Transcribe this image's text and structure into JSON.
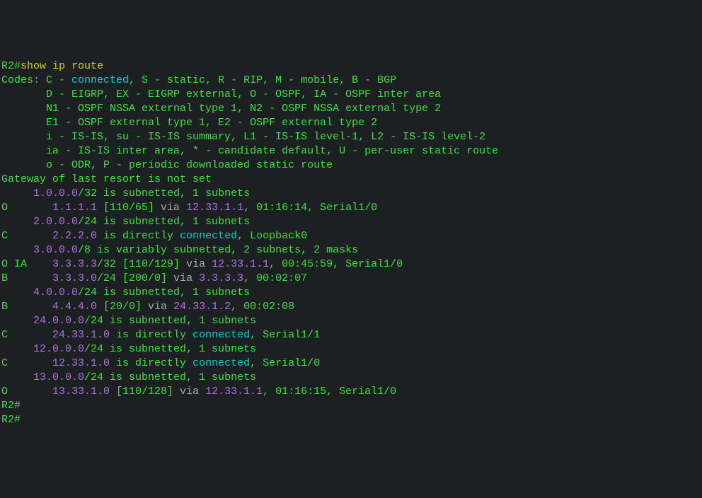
{
  "prompt_host": "R2#",
  "command": "show ip route",
  "codes_header": "Codes: ",
  "codes_lines": [
    {
      "indent": "",
      "parts": [
        {
          "t": "C - ",
          "c": "green"
        },
        {
          "t": "connected",
          "c": "cyan"
        },
        {
          "t": ", S - static, R - RIP, M - mobile, B - BGP",
          "c": "green"
        }
      ]
    },
    {
      "indent": "       ",
      "parts": [
        {
          "t": "D - EIGRP, EX - EIGRP external, O - OSPF, IA - OSPF inter area",
          "c": "green"
        }
      ]
    },
    {
      "indent": "       ",
      "parts": [
        {
          "t": "N1 - OSPF NSSA external type 1, N2 - OSPF NSSA external type 2",
          "c": "green"
        }
      ]
    },
    {
      "indent": "       ",
      "parts": [
        {
          "t": "E1 - OSPF external type 1, E2 - OSPF external type 2",
          "c": "green"
        }
      ]
    },
    {
      "indent": "       ",
      "parts": [
        {
          "t": "i - IS-IS, su - IS-IS summary, L1 - IS-IS level-1, L2 - IS-IS level-2",
          "c": "green"
        }
      ]
    },
    {
      "indent": "       ",
      "parts": [
        {
          "t": "ia - IS-IS inter area, * - candidate default, U - per-user static route",
          "c": "green"
        }
      ]
    },
    {
      "indent": "       ",
      "parts": [
        {
          "t": "o - ODR, P - periodic downloaded static route",
          "c": "green"
        }
      ]
    }
  ],
  "blank": "",
  "gateway_line": "Gateway of last resort is not set",
  "routes": [
    {
      "parts": [
        {
          "t": "     ",
          "c": "green"
        },
        {
          "t": "1.0.0.0",
          "c": "purple"
        },
        {
          "t": "/32 is subnetted, 1 subnets",
          "c": "green"
        }
      ]
    },
    {
      "parts": [
        {
          "t": "O       ",
          "c": "green"
        },
        {
          "t": "1.1.1.1",
          "c": "purple"
        },
        {
          "t": " [110/65] ",
          "c": "green"
        },
        {
          "t": "via",
          "c": "gray"
        },
        {
          "t": " ",
          "c": "green"
        },
        {
          "t": "12.33.1.1",
          "c": "purple"
        },
        {
          "t": ", 01:16:14, Serial1/0",
          "c": "green"
        }
      ]
    },
    {
      "parts": [
        {
          "t": "     ",
          "c": "green"
        },
        {
          "t": "2.0.0.0",
          "c": "purple"
        },
        {
          "t": "/24 is subnetted, 1 subnets",
          "c": "green"
        }
      ]
    },
    {
      "parts": [
        {
          "t": "C       ",
          "c": "green"
        },
        {
          "t": "2.2.2.0",
          "c": "purple"
        },
        {
          "t": " is directly ",
          "c": "green"
        },
        {
          "t": "connected",
          "c": "cyan"
        },
        {
          "t": ", Loopback0",
          "c": "green"
        }
      ]
    },
    {
      "parts": [
        {
          "t": "     ",
          "c": "green"
        },
        {
          "t": "3.0.0.0",
          "c": "purple"
        },
        {
          "t": "/8 is variably subnetted, 2 subnets, 2 masks",
          "c": "green"
        }
      ]
    },
    {
      "parts": [
        {
          "t": "O IA    ",
          "c": "green"
        },
        {
          "t": "3.3.3.3",
          "c": "purple"
        },
        {
          "t": "/32 [110/129] ",
          "c": "green"
        },
        {
          "t": "via",
          "c": "gray"
        },
        {
          "t": " ",
          "c": "green"
        },
        {
          "t": "12.33.1.1",
          "c": "purple"
        },
        {
          "t": ", 00:45:59, Serial1/0",
          "c": "green"
        }
      ]
    },
    {
      "parts": [
        {
          "t": "B       ",
          "c": "green"
        },
        {
          "t": "3.3.3.0",
          "c": "purple"
        },
        {
          "t": "/24 [200/0] ",
          "c": "green"
        },
        {
          "t": "via",
          "c": "gray"
        },
        {
          "t": " ",
          "c": "green"
        },
        {
          "t": "3.3.3.3",
          "c": "purple"
        },
        {
          "t": ", 00:02:07",
          "c": "green"
        }
      ]
    },
    {
      "parts": [
        {
          "t": "     ",
          "c": "green"
        },
        {
          "t": "4.0.0.0",
          "c": "purple"
        },
        {
          "t": "/24 is subnetted, 1 subnets",
          "c": "green"
        }
      ]
    },
    {
      "parts": [
        {
          "t": "B       ",
          "c": "green"
        },
        {
          "t": "4.4.4.0",
          "c": "purple"
        },
        {
          "t": " [20/0] ",
          "c": "green"
        },
        {
          "t": "via",
          "c": "gray"
        },
        {
          "t": " ",
          "c": "green"
        },
        {
          "t": "24.33.1.2",
          "c": "purple"
        },
        {
          "t": ", 00:02:08",
          "c": "green"
        }
      ]
    },
    {
      "parts": [
        {
          "t": "     ",
          "c": "green"
        },
        {
          "t": "24.0.0.0",
          "c": "purple"
        },
        {
          "t": "/24 is subnetted, 1 subnets",
          "c": "green"
        }
      ]
    },
    {
      "parts": [
        {
          "t": "C       ",
          "c": "green"
        },
        {
          "t": "24.33.1.0",
          "c": "purple"
        },
        {
          "t": " is directly ",
          "c": "green"
        },
        {
          "t": "connected",
          "c": "cyan"
        },
        {
          "t": ", Serial1/1",
          "c": "green"
        }
      ]
    },
    {
      "parts": [
        {
          "t": "     ",
          "c": "green"
        },
        {
          "t": "12.0.0.0",
          "c": "purple"
        },
        {
          "t": "/24 is subnetted, 1 subnets",
          "c": "green"
        }
      ]
    },
    {
      "parts": [
        {
          "t": "C       ",
          "c": "green"
        },
        {
          "t": "12.33.1.0",
          "c": "purple"
        },
        {
          "t": " is directly ",
          "c": "green"
        },
        {
          "t": "connected",
          "c": "cyan"
        },
        {
          "t": ", Serial1/0",
          "c": "green"
        }
      ]
    },
    {
      "parts": [
        {
          "t": "     ",
          "c": "green"
        },
        {
          "t": "13.0.0.0",
          "c": "purple"
        },
        {
          "t": "/24 is subnetted, 1 subnets",
          "c": "green"
        }
      ]
    },
    {
      "parts": [
        {
          "t": "O       ",
          "c": "green"
        },
        {
          "t": "13.33.1.0",
          "c": "purple"
        },
        {
          "t": " [110/128] ",
          "c": "green"
        },
        {
          "t": "via",
          "c": "gray"
        },
        {
          "t": " ",
          "c": "green"
        },
        {
          "t": "12.33.1.1",
          "c": "purple"
        },
        {
          "t": ", 01:16:15, Serial1/0",
          "c": "green"
        }
      ]
    }
  ],
  "trailing_prompts": [
    "R2#",
    "R2#"
  ]
}
